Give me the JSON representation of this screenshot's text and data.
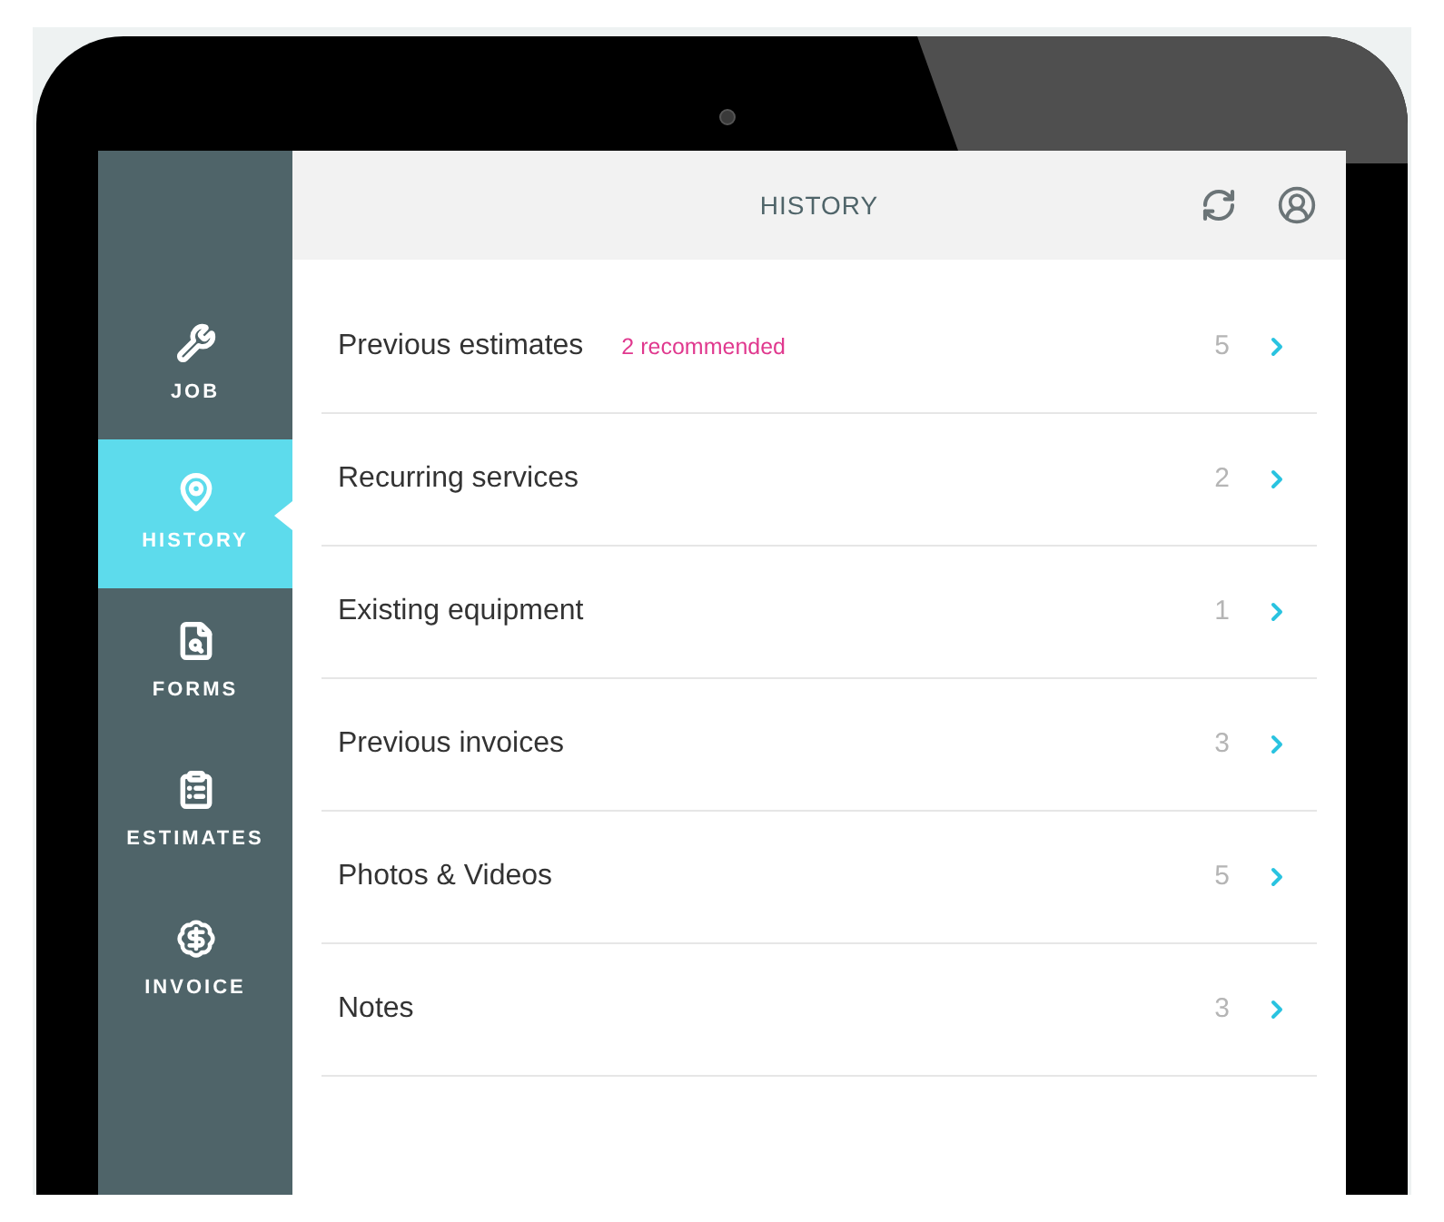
{
  "sidebar": {
    "items": [
      {
        "label": "JOB",
        "selected": false
      },
      {
        "label": "HISTORY",
        "selected": true
      },
      {
        "label": "FORMS",
        "selected": false
      },
      {
        "label": "ESTIMATES",
        "selected": false
      },
      {
        "label": "INVOICE",
        "selected": false
      }
    ]
  },
  "header": {
    "title": "HISTORY"
  },
  "rows": [
    {
      "label": "Previous estimates",
      "badge": "2 recommended",
      "count": "5"
    },
    {
      "label": "Recurring services",
      "count": "2"
    },
    {
      "label": "Existing equipment",
      "count": "1"
    },
    {
      "label": "Previous invoices",
      "count": "3"
    },
    {
      "label": "Photos & Videos",
      "count": "5"
    },
    {
      "label": "Notes",
      "count": "3"
    }
  ]
}
